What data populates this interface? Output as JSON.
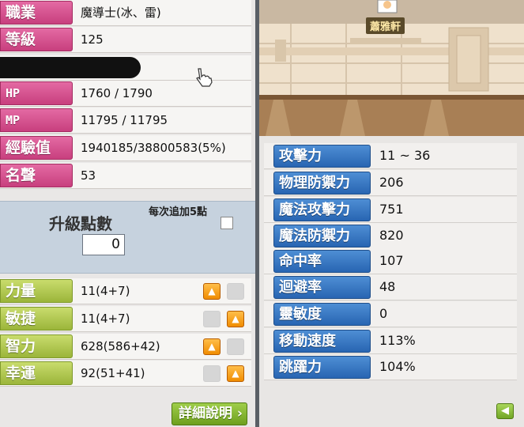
{
  "left": {
    "job_label": "職業",
    "job_value": "魔導士(冰、雷)",
    "level_label": "等級",
    "level_value": "125",
    "hp_label": "HP",
    "hp_value": "1760 / 1790",
    "mp_label": "MP",
    "mp_value": "11795 / 11795",
    "exp_label": "經驗值",
    "exp_value": "1940185/38800583(5%)",
    "fame_label": "名聲",
    "fame_value": "53"
  },
  "ap": {
    "title": "升級點數",
    "value": "0",
    "auto_label": "每次追加5點"
  },
  "stats": [
    {
      "label": "力量",
      "value": "11(4+7)"
    },
    {
      "label": "敏捷",
      "value": "11(4+7)"
    },
    {
      "label": "智力",
      "value": "628(586+42)"
    },
    {
      "label": "幸運",
      "value": "92(51+41)"
    }
  ],
  "detail_button": "詳細說明",
  "scene": {
    "npc_name": "蕭雅軒"
  },
  "right_stats": [
    {
      "label": "攻擊力",
      "value": "11 ~ 36"
    },
    {
      "label": "物理防禦力",
      "value": "206"
    },
    {
      "label": "魔法攻擊力",
      "value": "751"
    },
    {
      "label": "魔法防禦力",
      "value": "820"
    },
    {
      "label": "命中率",
      "value": "107"
    },
    {
      "label": "迴避率",
      "value": "48"
    },
    {
      "label": "靈敏度",
      "value": "0"
    },
    {
      "label": "移動速度",
      "value": "113%"
    },
    {
      "label": "跳躍力",
      "value": "104%"
    }
  ],
  "icons": {
    "up_arrow": "up-arrow-icon",
    "back_arrow": "back-arrow-icon",
    "cursor": "hand-cursor-icon"
  }
}
